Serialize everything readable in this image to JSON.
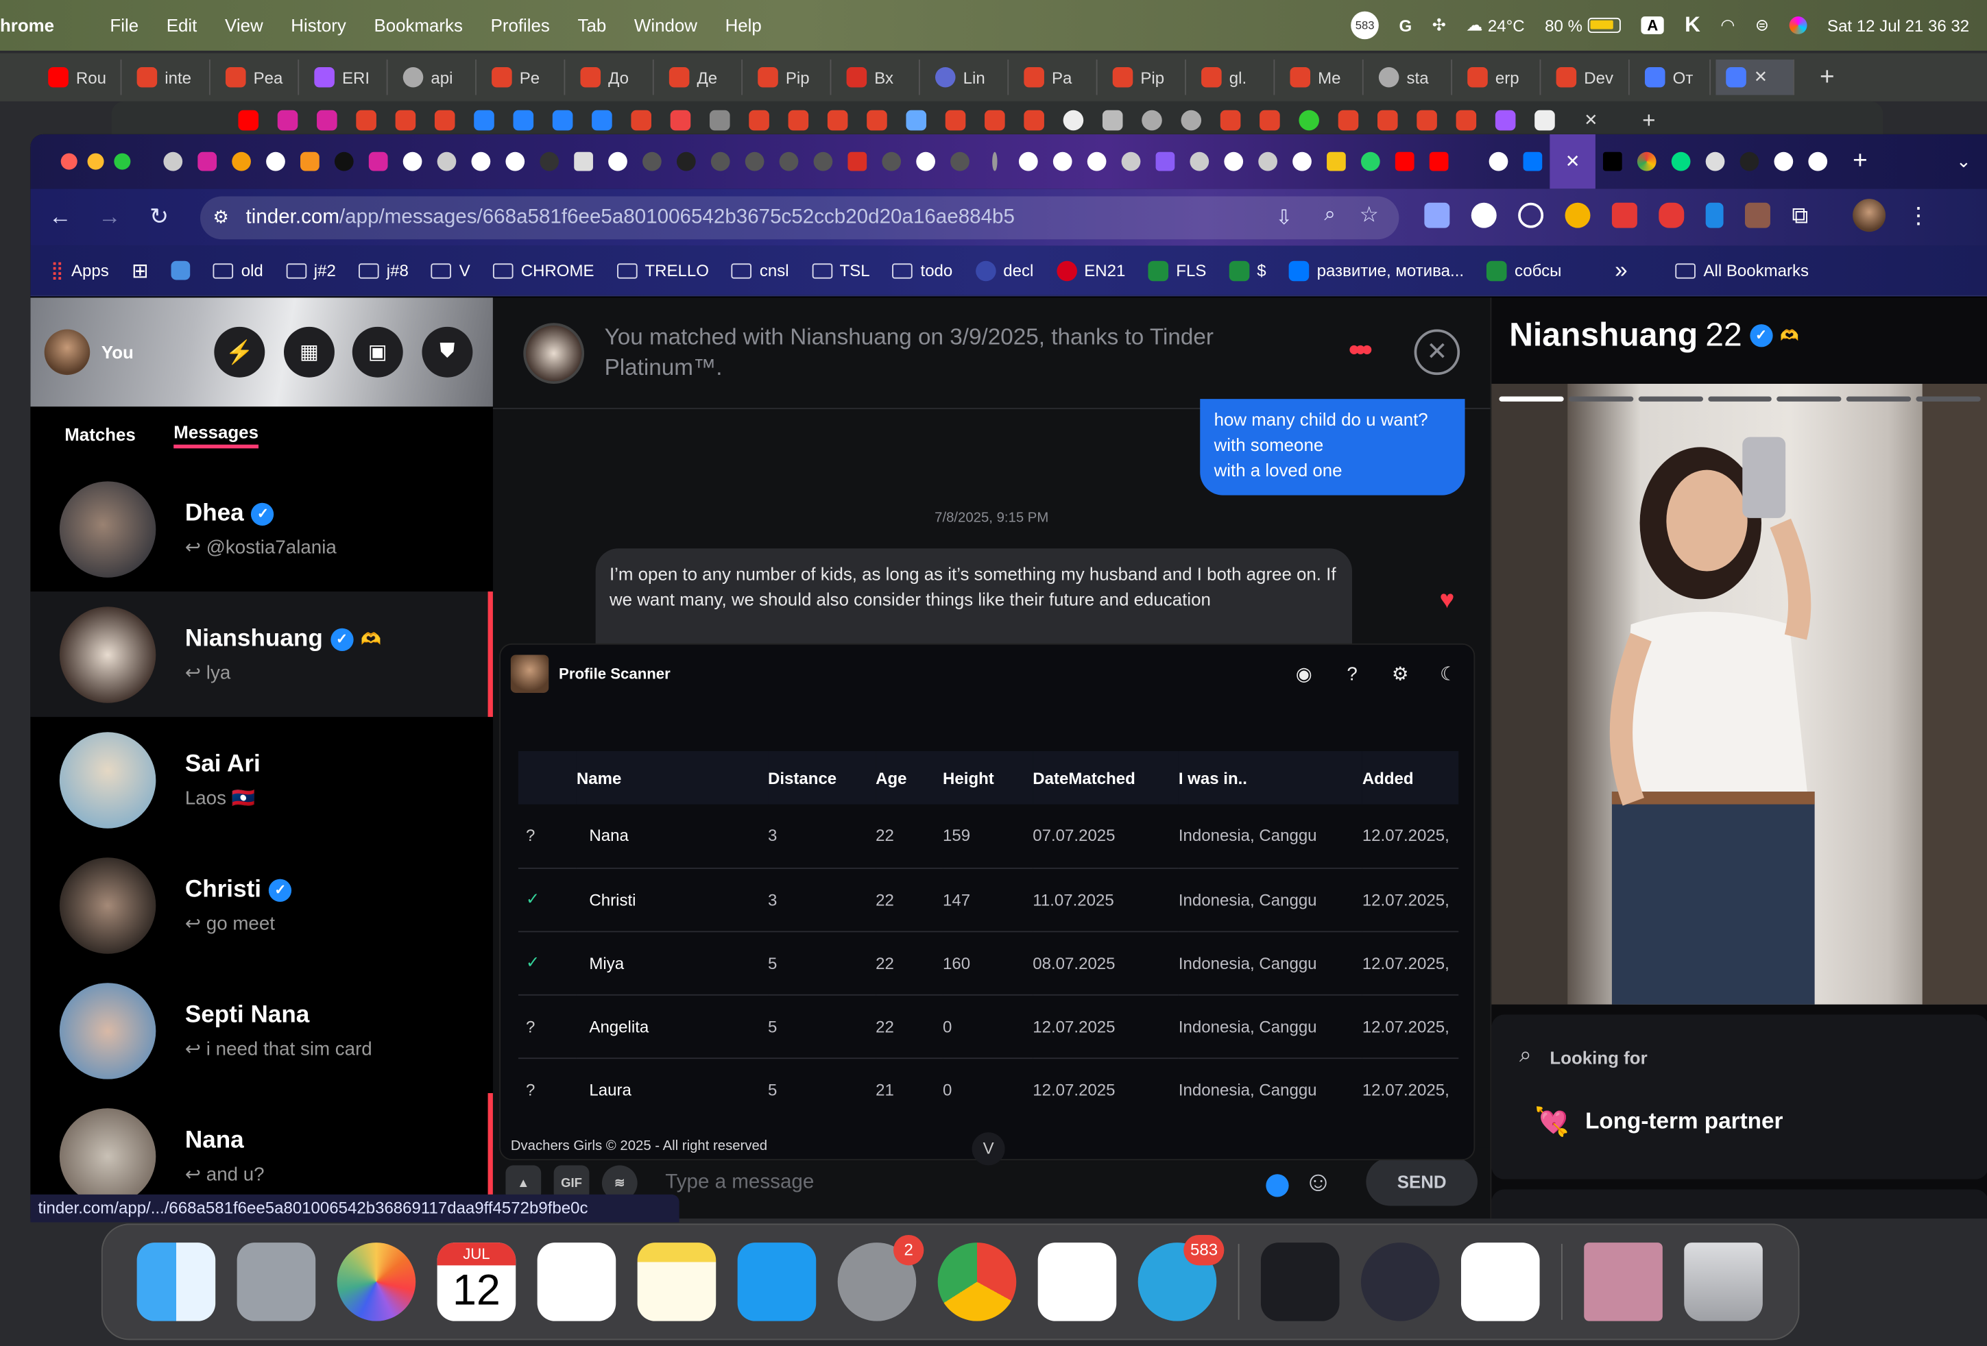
{
  "menubar": {
    "app": "hrome",
    "items": [
      "File",
      "Edit",
      "View",
      "History",
      "Bookmarks",
      "Profiles",
      "Tab",
      "Window",
      "Help"
    ],
    "tray": {
      "badge": "583",
      "weather": "24°C",
      "battery": "80 %",
      "input": "A",
      "datetime": "Sat 12 Jul  21 36 32"
    }
  },
  "bg_tabs": [
    "Rou",
    "inte",
    "Pea",
    "ERI",
    "api",
    "Pe",
    "До",
    "Де",
    "Pip",
    "Вх",
    "Lin",
    "Pa",
    "Pip",
    "gl.",
    "Me",
    "sta",
    "erp",
    "Dev",
    "От"
  ],
  "browser": {
    "url_host": "tinder.com",
    "url_path": "/app/messages/668a581f6ee5a801006542b3675c52ccb20d20a16ae884b5",
    "bookmarks": [
      "Apps",
      "old",
      "j#2",
      "j#8",
      "V",
      "CHROME",
      "TRELLO",
      "cnsl",
      "TSL",
      "todo",
      "decl",
      "EN21",
      "FLS",
      "$",
      "развитие, мотива...",
      "собсы"
    ],
    "all_bookmarks": "All Bookmarks",
    "more": "»"
  },
  "sidebar": {
    "user": "You",
    "tabs": {
      "matches": "Matches",
      "messages": "Messages"
    },
    "conversations": [
      {
        "name": "Dhea",
        "verified": true,
        "sub": "@kostia7alania",
        "reply": true
      },
      {
        "name": "Nianshuang",
        "verified": true,
        "sub": "lya",
        "reply": true,
        "extra": "🫶"
      },
      {
        "name": "Sai Ari",
        "verified": false,
        "sub": "Laos 🇱🇦",
        "reply": false
      },
      {
        "name": "Christi",
        "verified": true,
        "sub": "go meet",
        "reply": true
      },
      {
        "name": "Septi Nana",
        "verified": false,
        "sub": "i need that sim card",
        "reply": true
      },
      {
        "name": "Nana",
        "verified": false,
        "sub": "and u?",
        "reply": true
      }
    ]
  },
  "chat": {
    "header": "You matched with Nianshuang on 3/9/2025, thanks to Tinder Platinum™.",
    "sent_message": [
      "how many child do u want?",
      "with someone",
      "with a loved one"
    ],
    "timestamp": "7/8/2025, 9:15 PM",
    "received_message": "I’m open to any number of kids, as long as it’s something my husband and I both agree on. If we want many, we should also consider things like their future and education",
    "composer_placeholder": "Type a message",
    "send": "SEND",
    "gif": "GIF"
  },
  "scanner": {
    "title": "Profile Scanner",
    "columns": [
      "Name",
      "Distance",
      "Age",
      "Height",
      "DateMatched",
      "I was in..",
      "Added"
    ],
    "rows": [
      {
        "status": "?",
        "name": "Nana",
        "distance": "3",
        "age": "22",
        "height": "159",
        "date": "07.07.2025",
        "place": "Indonesia, Canggu",
        "added": "12.07.2025,"
      },
      {
        "status": "✓",
        "name": "Christi",
        "distance": "3",
        "age": "22",
        "height": "147",
        "date": "11.07.2025",
        "place": "Indonesia, Canggu",
        "added": "12.07.2025,"
      },
      {
        "status": "✓",
        "name": "Miya",
        "distance": "5",
        "age": "22",
        "height": "160",
        "date": "08.07.2025",
        "place": "Indonesia, Canggu",
        "added": "12.07.2025,"
      },
      {
        "status": "?",
        "name": "Angelita",
        "distance": "5",
        "age": "22",
        "height": "0",
        "date": "12.07.2025",
        "place": "Indonesia, Canggu",
        "added": "12.07.2025,"
      },
      {
        "status": "?",
        "name": "Laura",
        "distance": "5",
        "age": "21",
        "height": "0",
        "date": "12.07.2025",
        "place": "Indonesia, Canggu",
        "added": "12.07.2025,"
      }
    ],
    "footer": "Dvachers Girls © 2025 - All right reserved",
    "collapse": "V"
  },
  "profile": {
    "name": "Nianshuang",
    "age": "22",
    "looking_for_label": "Looking for",
    "looking_for_value": "Long-term partner",
    "photo_count": 7,
    "photo_index": 1
  },
  "status_url": "tinder.com/app/.../668a581f6ee5a801006542b36869117daa9ff4572b9fbe0c",
  "dock": {
    "calendar_month": "JUL",
    "calendar_day": "12",
    "settings_badge": "2",
    "telegram_badge": "583"
  },
  "colors": {
    "tinder_accent": "#fd3a73",
    "sent_bubble": "#1f6feb",
    "verified": "#1f8cff"
  }
}
